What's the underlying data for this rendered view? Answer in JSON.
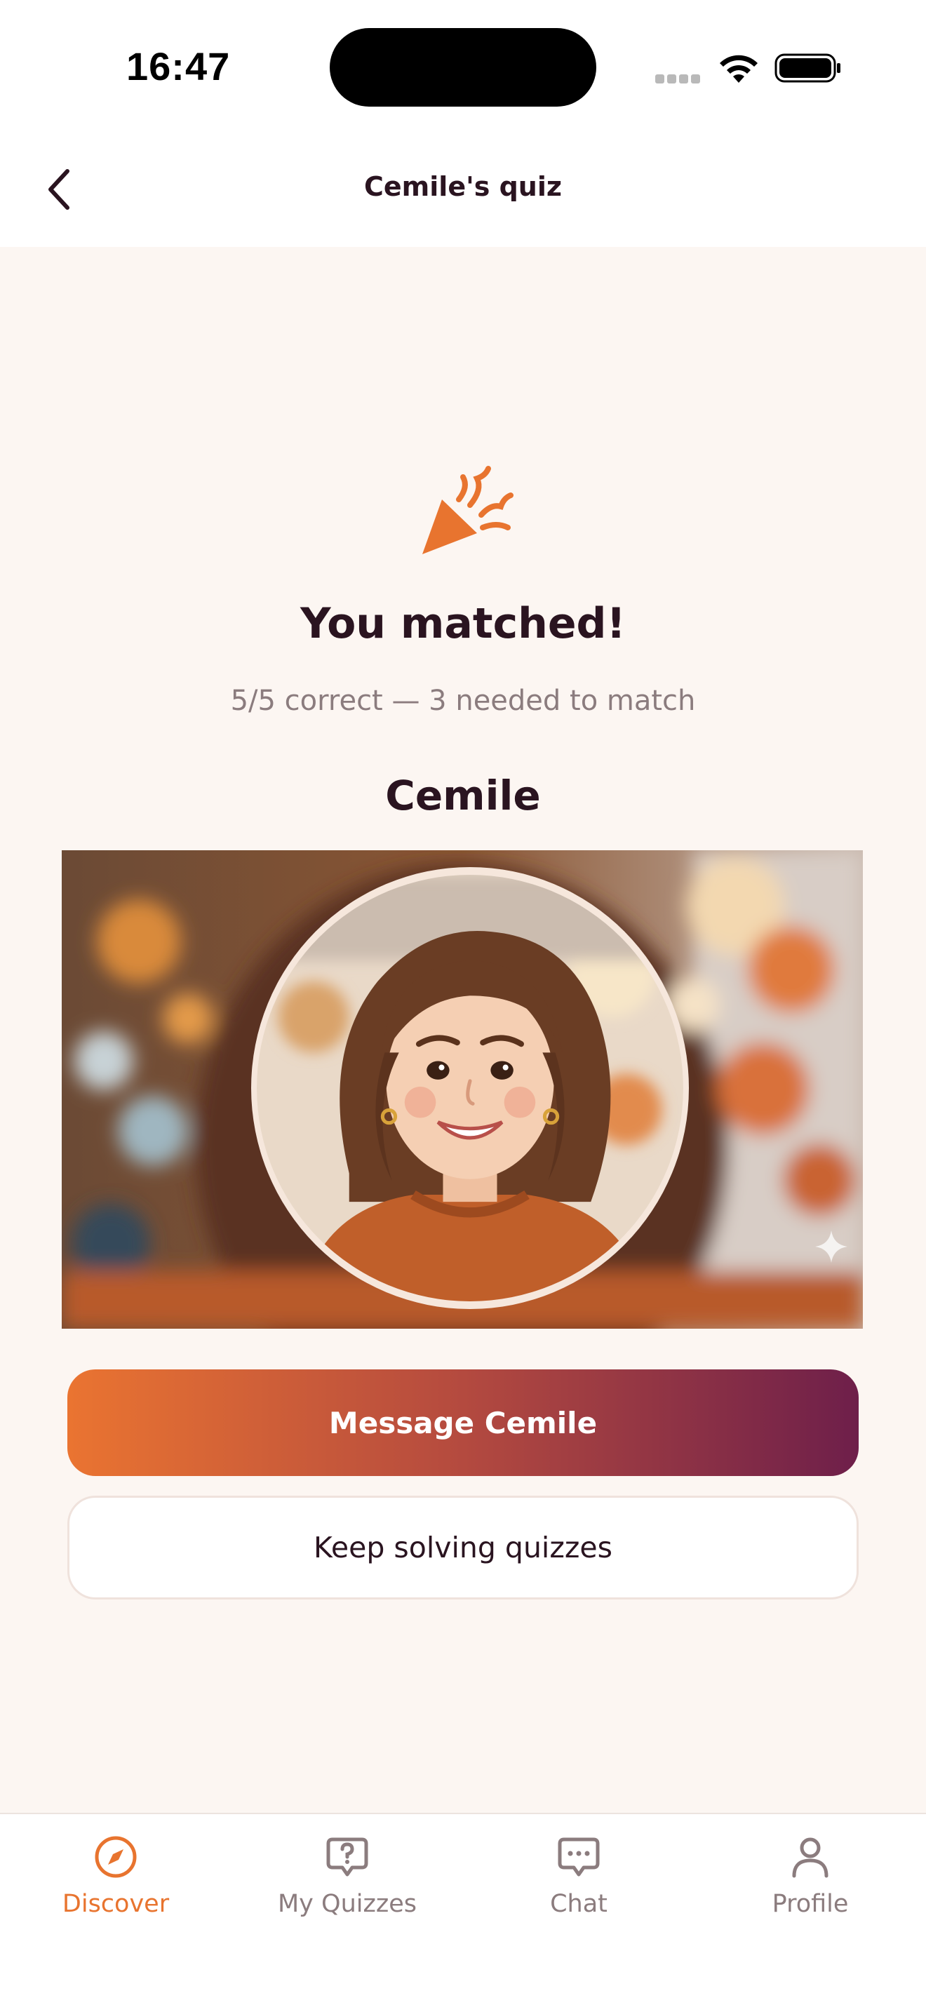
{
  "status_bar": {
    "time": "16:47"
  },
  "header": {
    "title": "Cemile's quiz",
    "back_icon": "chevron-left-icon"
  },
  "match": {
    "icon": "party-popper-icon",
    "title": "You matched!",
    "subtitle": "5/5 correct — 3 needed to match",
    "name": "Cemile"
  },
  "actions": {
    "primary_label": "Message Cemile",
    "secondary_label": "Keep solving quizzes"
  },
  "tabs": [
    {
      "label": "Discover",
      "icon": "compass-icon",
      "active": true
    },
    {
      "label": "My Quizzes",
      "icon": "quiz-bubble-icon",
      "active": false
    },
    {
      "label": "Chat",
      "icon": "chat-icon",
      "active": false
    },
    {
      "label": "Profile",
      "icon": "person-icon",
      "active": false
    }
  ],
  "colors": {
    "accent": "#e8742f",
    "gradient_start": "#ea7431",
    "gradient_end": "#6e1f4a",
    "text_dark": "#2a1420",
    "text_muted": "#8b7c7e",
    "background": "#fcf6f2"
  }
}
